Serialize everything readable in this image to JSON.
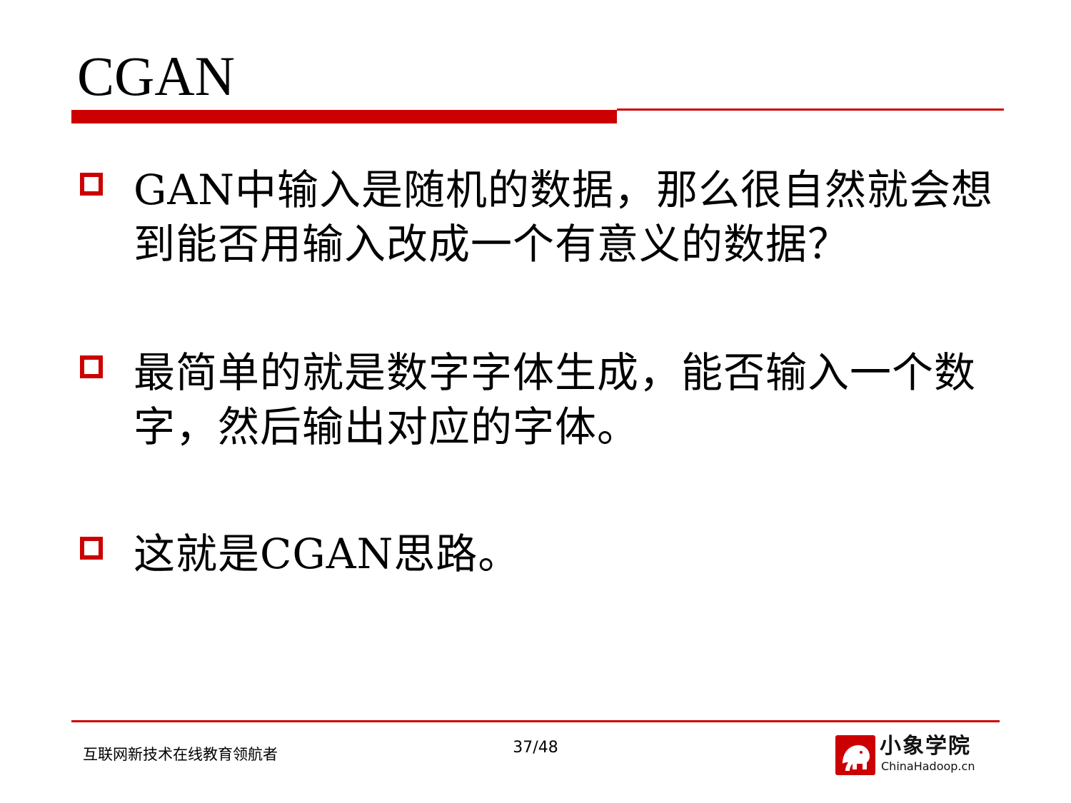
{
  "slide": {
    "title": "CGAN"
  },
  "bullets": [
    {
      "text": "GAN中输入是随机的数据，那么很自然就会想到能否用输入改成一个有意义的数据？"
    },
    {
      "text": "最简单的就是数字字体生成，能否输入一个数字，然后输出对应的字体。"
    },
    {
      "text": "这就是CGAN思路。"
    }
  ],
  "footer": {
    "tagline": "互联网新技术在线教育领航者",
    "page_number": "37/48",
    "logo_text": "小象学院",
    "logo_url_text": "ChinaHadoop.cn"
  },
  "colors": {
    "accent": "#cc0000",
    "text": "#000000",
    "background": "#ffffff"
  },
  "icons": {
    "bullet": "hollow-square-icon",
    "logo": "elephant-logo-icon"
  }
}
